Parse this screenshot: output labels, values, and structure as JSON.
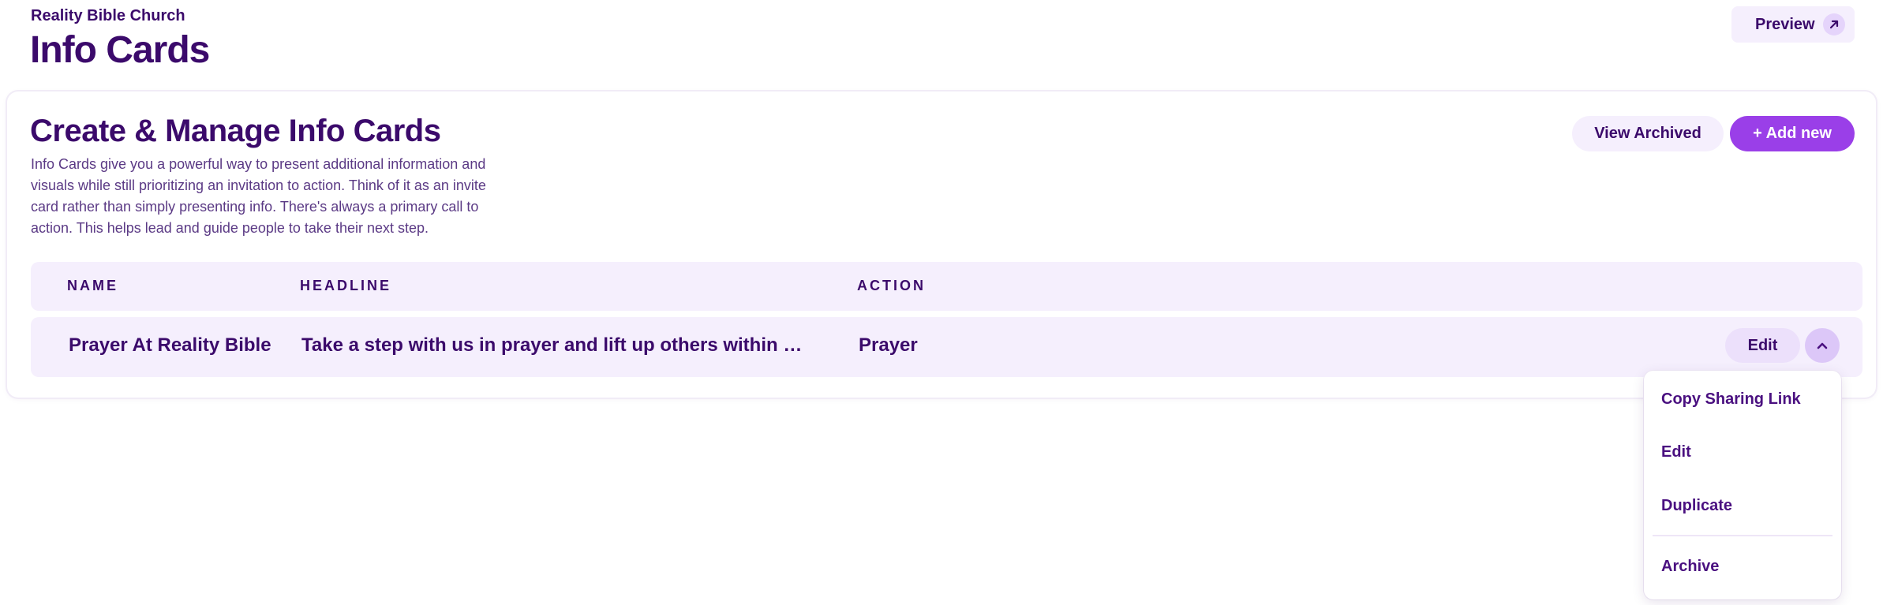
{
  "header": {
    "org_name": "Reality Bible Church",
    "title": "Info Cards",
    "preview_label": "Preview"
  },
  "card": {
    "title": "Create & Manage Info Cards",
    "description": "Info Cards give you a powerful way to present additional information and visuals while still prioritizing an invitation to action. Think of it as an invite card rather than simply presenting info. There's always a primary call to action. This helps lead and guide people to take their next step.",
    "view_archived_label": "View Archived",
    "add_new_label": "+ Add new"
  },
  "table": {
    "columns": [
      "NAME",
      "HEADLINE",
      "ACTION"
    ],
    "rows": [
      {
        "name": "Prayer At Reality Bible",
        "headline": "Take a step with us in prayer and lift up others within our c...",
        "action": "Prayer",
        "edit_label": "Edit"
      }
    ]
  },
  "row_menu": {
    "items": [
      "Copy Sharing Link",
      "Edit",
      "Duplicate",
      "Archive"
    ]
  },
  "colors": {
    "primary_text": "#3b0a6b",
    "accent": "#9a3fe8",
    "surface_tint": "#f5effd"
  },
  "icons": {
    "preview": "arrow-up-right-icon",
    "row_toggle": "chevron-up-icon"
  }
}
